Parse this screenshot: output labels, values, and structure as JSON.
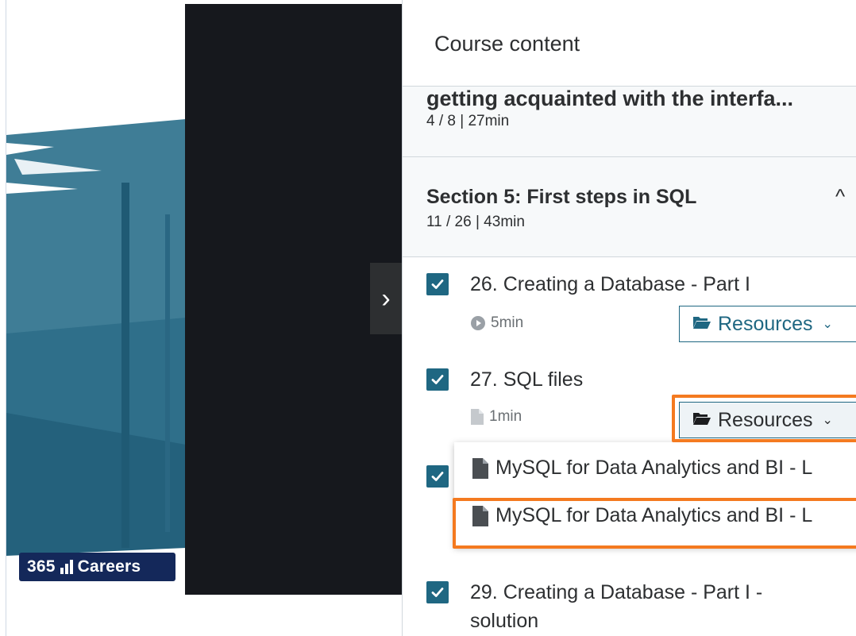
{
  "sidebar": {
    "title": "Course content",
    "prev_section": {
      "title": "getting acquainted with the interfa...",
      "meta": "4 / 8 | 27min"
    },
    "current_section": {
      "title": "Section 5: First steps in SQL",
      "meta": "11 / 26 | 43min"
    },
    "lectures": [
      {
        "title": "26. Creating a Database - Part I",
        "duration": "5min",
        "resources_label": "Resources"
      },
      {
        "title": "27. SQL files",
        "duration": "1min",
        "resources_label": "Resources"
      },
      {
        "title": "29. Creating a Database - Part I -",
        "title_line2": "solution"
      }
    ],
    "resources_dropdown": {
      "items": [
        "MySQL for Data Analytics and BI - L",
        "MySQL for Data Analytics and BI - L"
      ]
    }
  },
  "brand": {
    "number": "365",
    "name": "Careers"
  },
  "colors": {
    "accent": "#1f6782",
    "highlight": "#f47a20",
    "video_bg": "#16181d",
    "badge": "#14285a"
  }
}
